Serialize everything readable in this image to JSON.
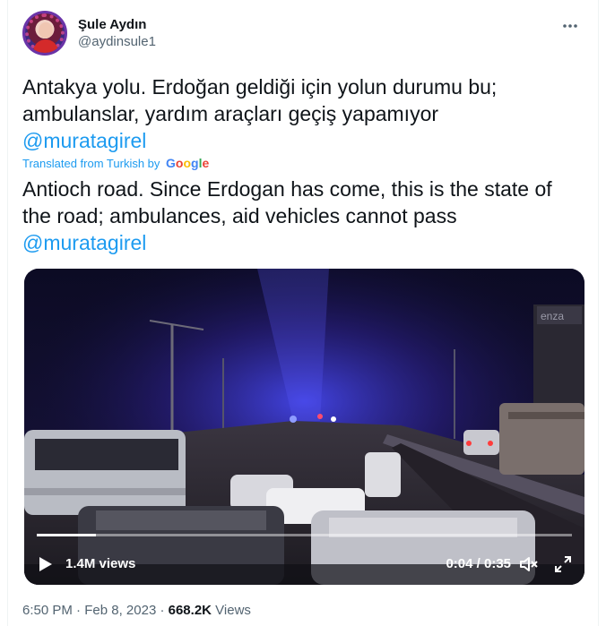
{
  "author": {
    "display_name": "Şule Aydın",
    "handle": "@aydinsule1",
    "more_icon": "more-horizontal-icon"
  },
  "tweet": {
    "original_text": "Antakya yolu. Erdoğan geldiği için yolun durumu bu; ambulanslar, yardım araçları geçiş yapamıyor",
    "original_mention": "@muratagirel",
    "translated_label": "Translated from Turkish by",
    "translator": "Google",
    "translated_text": "Antioch road. Since Erdogan has come, this is the state of the road; ambulances, aid vehicles cannot pass",
    "translated_mention": "@muratagirel"
  },
  "video": {
    "views": "1.4M views",
    "time": "0:04 / 0:35",
    "progress": 0.11,
    "play_icon": "play-icon",
    "mute_icon": "volume-muted-icon",
    "fullscreen_icon": "fullscreen-icon",
    "sign_text": "enza",
    "accent_colors": {
      "police_blue": "#3b4bff",
      "sky": "#1a1540"
    }
  },
  "meta": {
    "time": "6:50 PM",
    "date": "Feb 8, 2023",
    "separator": "·",
    "view_count": "668.2K",
    "views_label": "Views"
  }
}
